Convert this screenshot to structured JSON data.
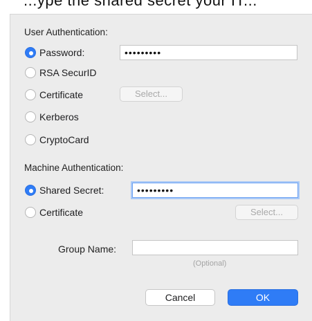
{
  "window_header": {
    "partial_text": "...ype the shared secret your IT..."
  },
  "user_auth": {
    "section_label": "User Authentication:",
    "options": [
      {
        "label": "Password:",
        "selected": true
      },
      {
        "label": "RSA SecurID",
        "selected": false
      },
      {
        "label": "Certificate",
        "selected": false
      },
      {
        "label": "Kerberos",
        "selected": false
      },
      {
        "label": "CryptoCard",
        "selected": false
      }
    ],
    "password_value": "•••••••••",
    "certificate_select_label": "Select..."
  },
  "machine_auth": {
    "section_label": "Machine Authentication:",
    "options": [
      {
        "label": "Shared Secret:",
        "selected": true
      },
      {
        "label": "Certificate",
        "selected": false
      }
    ],
    "shared_secret_value": "•••••••••",
    "certificate_select_label": "Select..."
  },
  "group": {
    "label": "Group Name:",
    "value": "",
    "hint": "(Optional)"
  },
  "buttons": {
    "cancel": "Cancel",
    "ok": "OK"
  },
  "colors": {
    "accent": "#2f7cf6",
    "dialog_bg": "#ececec"
  }
}
